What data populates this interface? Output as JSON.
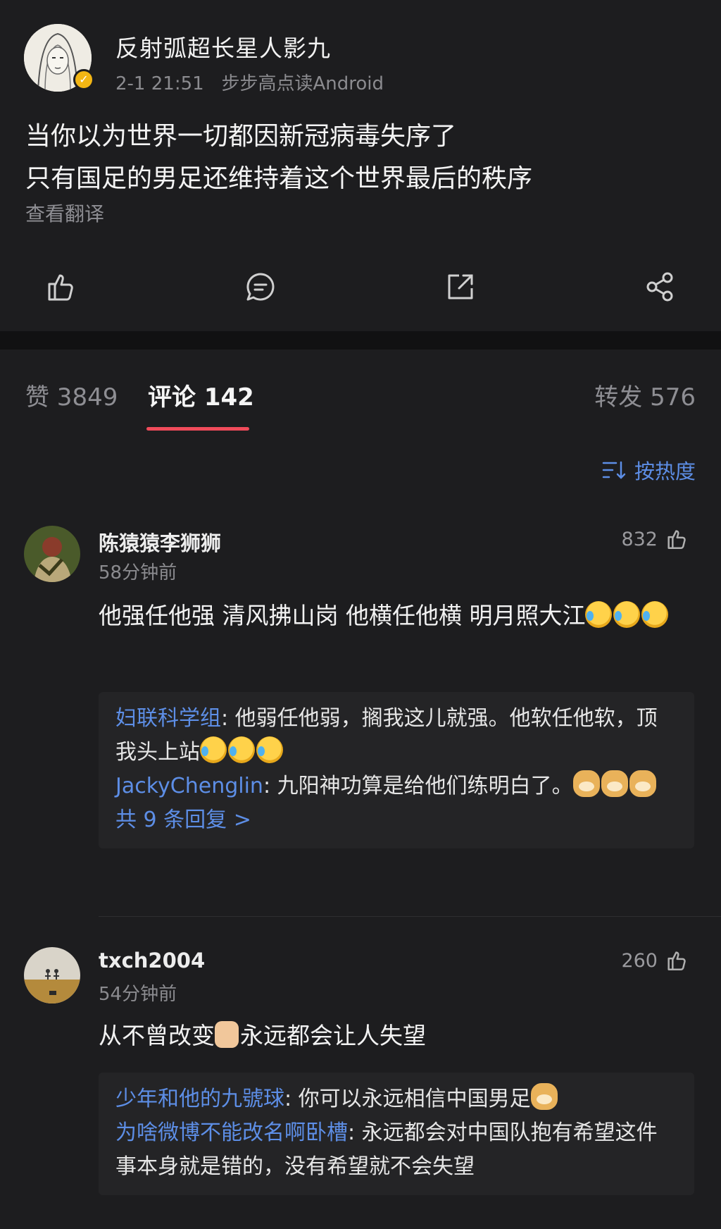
{
  "post": {
    "author": "反射弧超长星人影九",
    "timestamp": "2-1 21:51",
    "source": "步步高点读Android",
    "text_line1": "当你以为世界一切都因新冠病毒失序了",
    "text_line2": "只有国足的男足还维持着这个世界最后的秩序",
    "translate_label": "查看翻译",
    "actions": [
      "like-icon",
      "comment-icon",
      "repost-icon",
      "share-icon"
    ]
  },
  "tabs": {
    "likes": "赞 3849",
    "comments": "评论 142",
    "reposts": "转发 576"
  },
  "sort": {
    "label": "按热度",
    "icon": "sort-icon"
  },
  "comments": [
    {
      "name": "陈猿猿李狮狮",
      "time": "58分钟前",
      "likes": "832",
      "text": "他强任他强 清风拂山岗 他横任他横 明月照大江",
      "emojis": [
        "crying-emoji",
        "crying-emoji",
        "crying-emoji"
      ],
      "replies": [
        {
          "name": "妇联科学组",
          "text": ": 他弱任他弱，搁我这儿就强。他软任他软，顶我头上站"
        },
        {
          "name": "JackyChenglin",
          "text": ": 九阳神功算是给他们练明白了。"
        }
      ],
      "more": "共 9 条回复 >"
    },
    {
      "name": "txch2004",
      "time": "54分钟前",
      "likes": "260",
      "text_a": "从不曾改变",
      "text_b": "永远都会让人失望",
      "replies": [
        {
          "name": "少年和他的九號球",
          "text": ": 你可以永远相信中国男足"
        },
        {
          "name": "为啥微博不能改名啊卧槽",
          "text": ": 永远都会对中国队抱有希望这件事本身就是错的，没有希望就不会失望"
        }
      ]
    }
  ],
  "colors": {
    "accent_blue": "#5d8ee6",
    "tab_underline": "#f04b5a",
    "background": "#1d1d1f"
  }
}
